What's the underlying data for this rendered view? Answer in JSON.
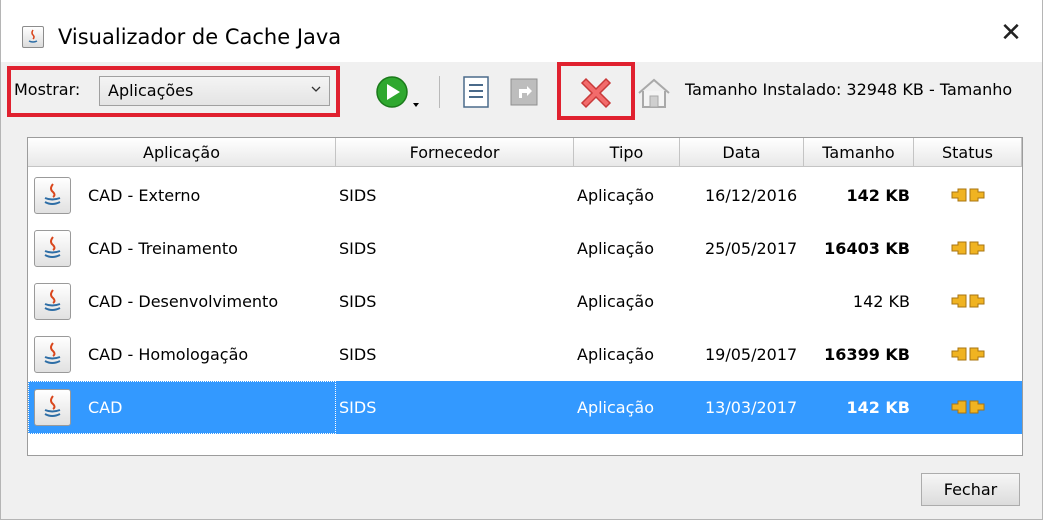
{
  "window": {
    "title": "Visualizador de Cache Java"
  },
  "toolbar": {
    "show_label": "Mostrar:",
    "show_value": "Aplicações",
    "size_info": "Tamanho Instalado:  32948 KB - Tamanho"
  },
  "table": {
    "columns": [
      "Aplicação",
      "Fornecedor",
      "Tipo",
      "Data",
      "Tamanho",
      "Status"
    ],
    "rows": [
      {
        "app": "CAD - Externo",
        "vendor": "SIDS",
        "type": "Aplicação",
        "date": "16/12/2016",
        "size": "142 KB",
        "size_bold": true,
        "selected": false
      },
      {
        "app": "CAD - Treinamento",
        "vendor": "SIDS",
        "type": "Aplicação",
        "date": "25/05/2017",
        "size": "16403 KB",
        "size_bold": true,
        "selected": false
      },
      {
        "app": "CAD - Desenvolvimento",
        "vendor": "SIDS",
        "type": "Aplicação",
        "date": "",
        "size": "142 KB",
        "size_bold": false,
        "selected": false
      },
      {
        "app": "CAD - Homologação",
        "vendor": "SIDS",
        "type": "Aplicação",
        "date": "19/05/2017",
        "size": "16399 KB",
        "size_bold": true,
        "selected": false
      },
      {
        "app": "CAD",
        "vendor": "SIDS",
        "type": "Aplicação",
        "date": "13/03/2017",
        "size": "142 KB",
        "size_bold": true,
        "selected": true
      }
    ]
  },
  "footer": {
    "close_label": "Fechar"
  },
  "colors": {
    "highlight": "#e0212f",
    "selection": "#3399ff",
    "run_green": "#2fa82f"
  },
  "icons": [
    "java-app-icon",
    "close-icon",
    "chevron-down-icon",
    "run-icon",
    "show-jnlp-icon",
    "install-shortcut-icon",
    "delete-icon",
    "home-icon",
    "status-plugged-icon"
  ]
}
